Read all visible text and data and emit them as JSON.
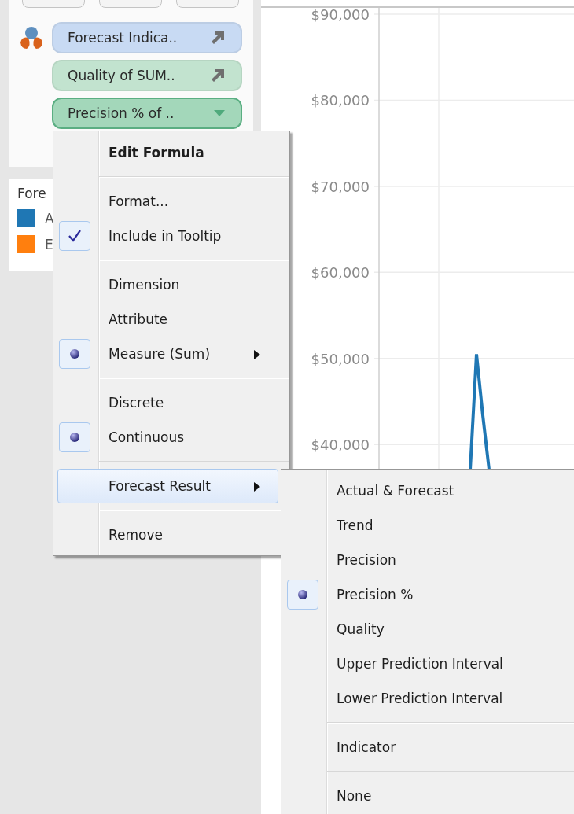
{
  "marks_card": {
    "pills": [
      {
        "label": "Forecast Indica..",
        "color": "#c8daf3",
        "selected": false
      },
      {
        "label": "Quality of SUM..",
        "color": "#c2e3cf",
        "selected": false
      },
      {
        "label": "Precision % of ..",
        "color": "#a3d7ba",
        "selected": true
      }
    ]
  },
  "legend": {
    "title": "Fore",
    "items": [
      {
        "label": "A",
        "color": "#1f77b4"
      },
      {
        "label": "E",
        "color": "#ff7f0e"
      }
    ]
  },
  "chart": {
    "chart_data": {
      "type": "line",
      "ylim": [
        35000,
        90000
      ],
      "grid": true,
      "categories": [
        null,
        null,
        null,
        null,
        null,
        null,
        null,
        null,
        null,
        null,
        null,
        null,
        null,
        null,
        null,
        null,
        null,
        null,
        null,
        null,
        null,
        null,
        null,
        null,
        null,
        null,
        null,
        null,
        null,
        null,
        null
      ],
      "yticks": [
        {
          "value": 90000,
          "label": "$90,000"
        },
        {
          "value": 80000,
          "label": "$80,000"
        },
        {
          "value": 70000,
          "label": "$70,000"
        },
        {
          "value": 60000,
          "label": "$60,000"
        },
        {
          "value": 50000,
          "label": "$50,000"
        },
        {
          "value": 40000,
          "label": "$40,000"
        }
      ],
      "series": [
        {
          "color": "#1f77b4",
          "values": [
            null,
            null,
            null,
            null,
            null,
            null,
            null,
            null,
            null,
            null,
            null,
            null,
            null,
            null,
            37100,
            50500,
            43400,
            37100,
            null,
            null,
            null,
            null,
            null,
            null,
            null,
            null,
            null,
            null,
            null,
            null,
            null
          ]
        }
      ]
    }
  },
  "context_menu": {
    "groups": [
      [
        {
          "label": "Edit Formula",
          "kind": "command",
          "default": true,
          "checked": false,
          "has_submenu": false,
          "selected": false
        }
      ],
      [
        {
          "label": "Format...",
          "kind": "command",
          "default": false,
          "checked": false,
          "has_submenu": false,
          "selected": false
        },
        {
          "label": "Include in Tooltip",
          "kind": "check",
          "default": false,
          "checked": true,
          "has_submenu": false,
          "selected": false
        }
      ],
      [
        {
          "label": "Dimension",
          "kind": "radio",
          "default": false,
          "checked": false,
          "has_submenu": false,
          "selected": false
        },
        {
          "label": "Attribute",
          "kind": "radio",
          "default": false,
          "checked": false,
          "has_submenu": false,
          "selected": false
        },
        {
          "label": "Measure (Sum)",
          "kind": "radio",
          "default": false,
          "checked": true,
          "has_submenu": true,
          "selected": false
        }
      ],
      [
        {
          "label": "Discrete",
          "kind": "radio",
          "default": false,
          "checked": false,
          "has_submenu": false,
          "selected": false
        },
        {
          "label": "Continuous",
          "kind": "radio",
          "default": false,
          "checked": true,
          "has_submenu": false,
          "selected": false
        }
      ],
      [
        {
          "label": "Forecast Result",
          "kind": "command",
          "default": false,
          "checked": false,
          "has_submenu": true,
          "selected": true
        }
      ],
      [
        {
          "label": "Remove",
          "kind": "command",
          "default": false,
          "checked": false,
          "has_submenu": false,
          "selected": false
        }
      ]
    ]
  },
  "submenu": {
    "groups": [
      [
        {
          "label": "Actual & Forecast",
          "kind": "radio",
          "default": false,
          "checked": false,
          "has_submenu": false,
          "selected": false
        },
        {
          "label": "Trend",
          "kind": "radio",
          "default": false,
          "checked": false,
          "has_submenu": false,
          "selected": false
        },
        {
          "label": "Precision",
          "kind": "radio",
          "default": false,
          "checked": false,
          "has_submenu": false,
          "selected": false
        },
        {
          "label": "Precision %",
          "kind": "radio",
          "default": false,
          "checked": true,
          "has_submenu": false,
          "selected": false
        },
        {
          "label": "Quality",
          "kind": "radio",
          "default": false,
          "checked": false,
          "has_submenu": false,
          "selected": false
        },
        {
          "label": "Upper Prediction Interval",
          "kind": "radio",
          "default": false,
          "checked": false,
          "has_submenu": false,
          "selected": false
        },
        {
          "label": "Lower Prediction Interval",
          "kind": "radio",
          "default": false,
          "checked": false,
          "has_submenu": false,
          "selected": false
        }
      ],
      [
        {
          "label": "Indicator",
          "kind": "radio",
          "default": false,
          "checked": false,
          "has_submenu": false,
          "selected": false
        }
      ],
      [
        {
          "label": "None",
          "kind": "radio",
          "default": false,
          "checked": false,
          "has_submenu": false,
          "selected": false
        }
      ]
    ]
  }
}
